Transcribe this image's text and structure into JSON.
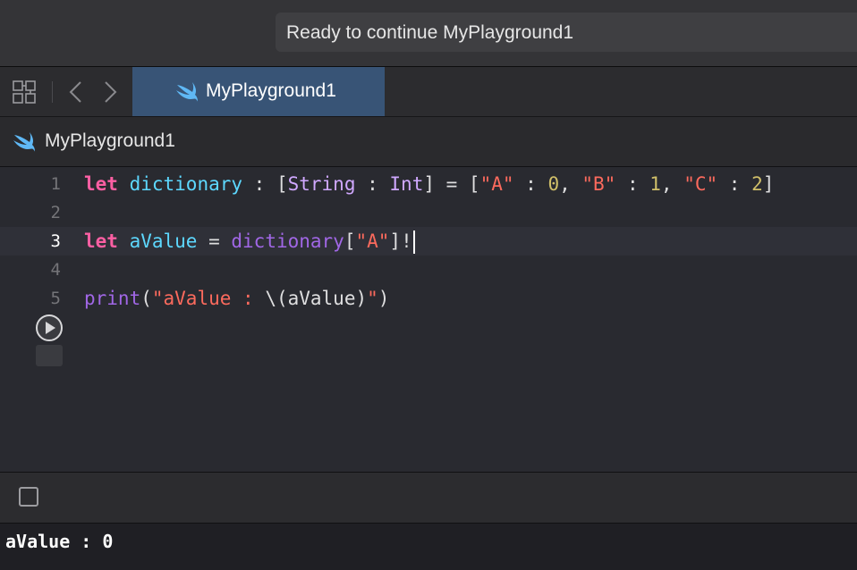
{
  "titlebar": {
    "status_text": "Ready to continue MyPlayground1"
  },
  "tabbar": {
    "grid_icon": "grid-icon",
    "back_icon": "chevron-left-icon",
    "forward_icon": "chevron-right-icon",
    "tab_label": "MyPlayground1",
    "tab_icon": "swift-icon"
  },
  "breadcrumb": {
    "label": "MyPlayground1",
    "icon": "swift-icon"
  },
  "editor": {
    "current_line": 3,
    "line_numbers": [
      "1",
      "2",
      "3",
      "4",
      "5"
    ],
    "lines": [
      [
        {
          "t": "let",
          "k": "kw"
        },
        {
          "t": " ",
          "k": "pl"
        },
        {
          "t": "dictionary",
          "k": "id"
        },
        {
          "t": " : [",
          "k": "pl"
        },
        {
          "t": "String",
          "k": "ty"
        },
        {
          "t": " : ",
          "k": "pl"
        },
        {
          "t": "Int",
          "k": "ty"
        },
        {
          "t": "] = [",
          "k": "pl"
        },
        {
          "t": "\"A\"",
          "k": "st"
        },
        {
          "t": " : ",
          "k": "pl"
        },
        {
          "t": "0",
          "k": "nu"
        },
        {
          "t": ", ",
          "k": "pl"
        },
        {
          "t": "\"B\"",
          "k": "st"
        },
        {
          "t": " : ",
          "k": "pl"
        },
        {
          "t": "1",
          "k": "nu"
        },
        {
          "t": ", ",
          "k": "pl"
        },
        {
          "t": "\"C\"",
          "k": "st"
        },
        {
          "t": " : ",
          "k": "pl"
        },
        {
          "t": "2",
          "k": "nu"
        },
        {
          "t": "]",
          "k": "pl"
        }
      ],
      [],
      [
        {
          "t": "let",
          "k": "kw"
        },
        {
          "t": " ",
          "k": "pl"
        },
        {
          "t": "aValue",
          "k": "id"
        },
        {
          "t": " = ",
          "k": "pl"
        },
        {
          "t": "dictionary",
          "k": "fn"
        },
        {
          "t": "[",
          "k": "pl"
        },
        {
          "t": "\"A\"",
          "k": "st"
        },
        {
          "t": "]!",
          "k": "pl"
        }
      ],
      [],
      [
        {
          "t": "print",
          "k": "fn"
        },
        {
          "t": "(",
          "k": "pl"
        },
        {
          "t": "\"aValue : ",
          "k": "st"
        },
        {
          "t": "\\(aValue)",
          "k": "pl"
        },
        {
          "t": "\"",
          "k": "st"
        },
        {
          "t": ")",
          "k": "pl"
        }
      ]
    ],
    "run_icon": "play-icon"
  },
  "debug": {
    "console_toggle_icon": "square-icon"
  },
  "console": {
    "output": "aValue : 0"
  },
  "colors": {
    "keyword": "#fc5fa3",
    "identifier": "#5dd8ff",
    "type": "#d0a8ff",
    "string": "#fc6a5d",
    "number": "#d0bf69",
    "function": "#a167e6",
    "tab_active": "#385476"
  }
}
